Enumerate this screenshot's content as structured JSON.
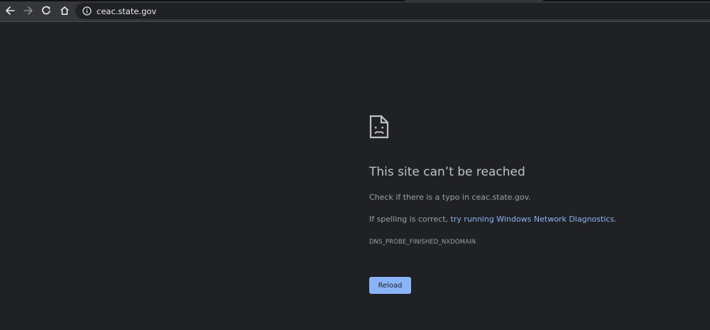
{
  "browser": {
    "url": "ceac.state.gov",
    "nav": {
      "back_icon": "arrow-left-icon",
      "forward_icon": "arrow-right-icon",
      "reload_icon": "reload-icon",
      "home_icon": "home-icon",
      "info_icon": "info-icon"
    }
  },
  "error_page": {
    "icon": "sad-page-icon",
    "heading": "This site can’t be reached",
    "typo_text": "Check if there is a typo in ceac.state.gov.",
    "spelling_prefix": "If spelling is correct, ",
    "diagnostics_link": "try running Windows Network Diagnostics",
    "spelling_suffix": ".",
    "error_code": "DNS_PROBE_FINISHED_NXDOMAIN",
    "reload_label": "Reload"
  },
  "colors": {
    "page_background": "#202124",
    "toolbar_background": "#35363a",
    "heading": "#bdc1c6",
    "body_text": "#9aa0a6",
    "link": "#8ab4f8",
    "button_background": "#8ab4f8"
  }
}
